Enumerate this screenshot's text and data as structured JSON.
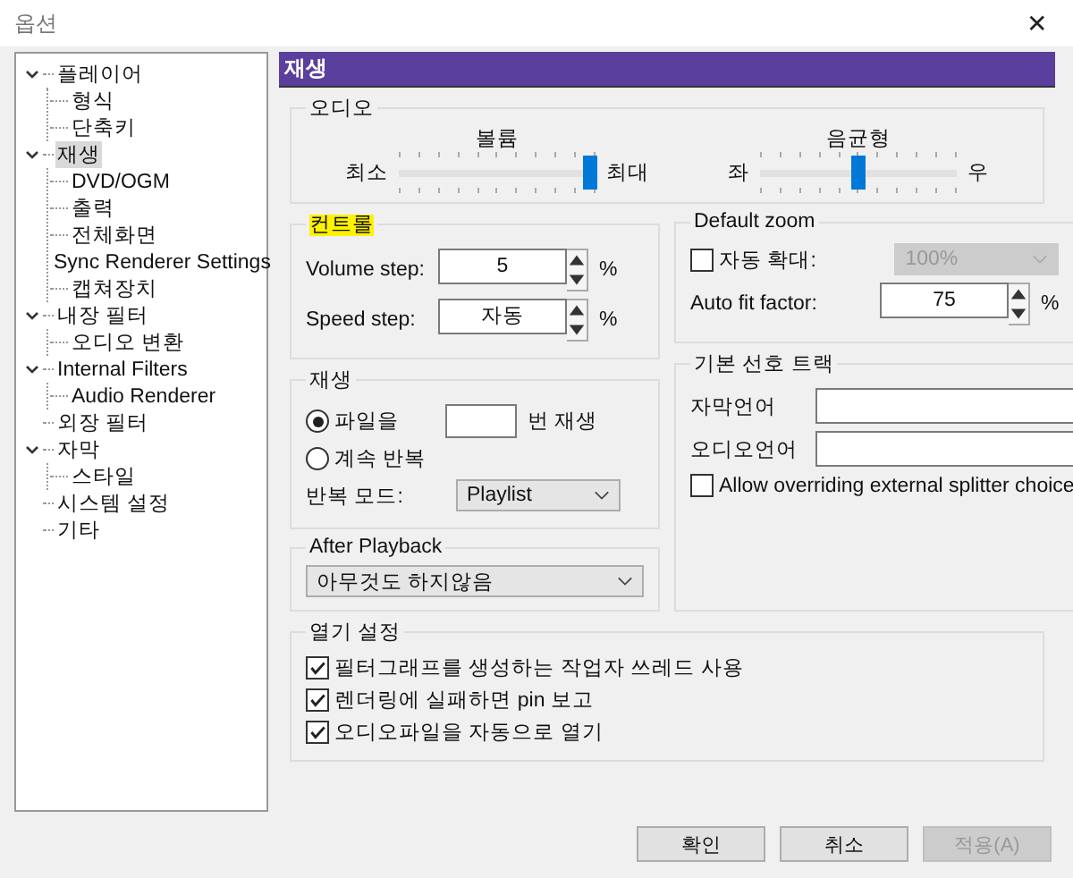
{
  "window": {
    "title": "옵션",
    "close": "✕"
  },
  "tree": [
    {
      "label": "플레이어",
      "expanded": true,
      "selected": false,
      "children": [
        {
          "label": "형식",
          "selected": false
        },
        {
          "label": "단축키",
          "selected": false
        }
      ]
    },
    {
      "label": "재생",
      "expanded": true,
      "selected": true,
      "children": [
        {
          "label": "DVD/OGM",
          "selected": false
        },
        {
          "label": "출력",
          "selected": false
        },
        {
          "label": "전체화면",
          "selected": false
        },
        {
          "label": "Sync Renderer Settings",
          "selected": false
        },
        {
          "label": "캡쳐장치",
          "selected": false
        }
      ]
    },
    {
      "label": "내장 필터",
      "expanded": true,
      "selected": false,
      "children": [
        {
          "label": "오디오 변환",
          "selected": false
        }
      ]
    },
    {
      "label": "Internal Filters",
      "expanded": true,
      "selected": false,
      "children": [
        {
          "label": "Audio Renderer",
          "selected": false
        }
      ]
    },
    {
      "label": "외장 필터",
      "selected": false
    },
    {
      "label": "자막",
      "expanded": true,
      "selected": false,
      "children": [
        {
          "label": "스타일",
          "selected": false
        }
      ]
    },
    {
      "label": "시스템 설정",
      "selected": false
    },
    {
      "label": "기타",
      "selected": false
    }
  ],
  "page": {
    "title": "재생",
    "audio": {
      "title": "오디오",
      "sliders": [
        {
          "label": "볼륨",
          "min_label": "최소",
          "max_label": "최대",
          "level": 0.97
        },
        {
          "label": "음균형",
          "min_label": "좌",
          "max_label": "우",
          "level": 0.5
        }
      ]
    },
    "controls": {
      "title": "컨트롤",
      "highlighted": true,
      "rows": [
        {
          "label": "Volume step:",
          "value": "5",
          "unit": "%"
        },
        {
          "label": "Speed step:",
          "value": "자동",
          "unit": "%"
        }
      ]
    },
    "default_zoom": {
      "title": "Default zoom",
      "auto_zoom": {
        "label": "자동 확대:",
        "checked": false
      },
      "zoom_select": {
        "value": "100%",
        "disabled": true
      },
      "auto_fit": {
        "label": "Auto fit factor:",
        "value": "75",
        "unit": "%"
      }
    },
    "playback": {
      "title": "재생",
      "radios": [
        {
          "label": "파일을",
          "selected": true,
          "suffix": "번 재생"
        },
        {
          "label": "계속 반복",
          "selected": false
        }
      ],
      "repeat_mode": {
        "label": "반복 모드:",
        "value": "Playlist"
      }
    },
    "after_playback": {
      "title": "After Playback",
      "value": "아무것도 하지않음"
    },
    "tracks": {
      "title": "기본 선호 트랙",
      "fields": [
        {
          "label": "자막언어"
        },
        {
          "label": "오디오언어"
        }
      ],
      "override": {
        "label": "Allow overriding external splitter choice",
        "checked": false
      }
    },
    "open_settings": {
      "title": "열기 설정",
      "options": [
        {
          "label": "필터그래프를 생성하는 작업자 쓰레드 사용",
          "checked": true
        },
        {
          "label": "렌더링에 실패하면 pin 보고",
          "checked": true
        },
        {
          "label": "오디오파일을 자동으로 열기",
          "checked": true
        }
      ]
    }
  },
  "buttons": [
    {
      "label": "확인",
      "disabled": false
    },
    {
      "label": "취소",
      "disabled": false
    },
    {
      "label": "적용(A)",
      "disabled": true
    }
  ]
}
